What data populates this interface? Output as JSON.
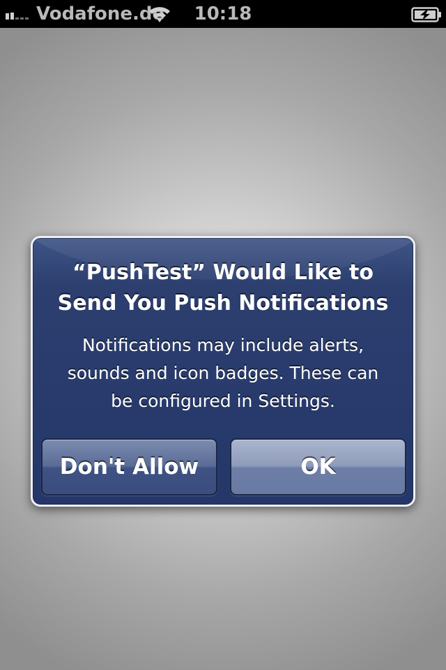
{
  "status_bar": {
    "carrier": "Vodafone.de",
    "time": "10:18",
    "icons": [
      "signal-icon",
      "wifi-icon",
      "battery-charging-icon"
    ]
  },
  "alert": {
    "title_line1": "“PushTest” Would Like to",
    "title_line2": "Send You Push Notifications",
    "message_line1": "Notifications may include alerts,",
    "message_line2": "sounds and icon badges. These can",
    "message_line3": "be configured in Settings.",
    "buttons": {
      "deny": "Don't Allow",
      "ok": "OK"
    }
  },
  "colors": {
    "alert_background": "#25376a",
    "alert_border": "#eef0f5",
    "status_text": "#b9b9b9",
    "screen_background": "#c9c9c9"
  }
}
